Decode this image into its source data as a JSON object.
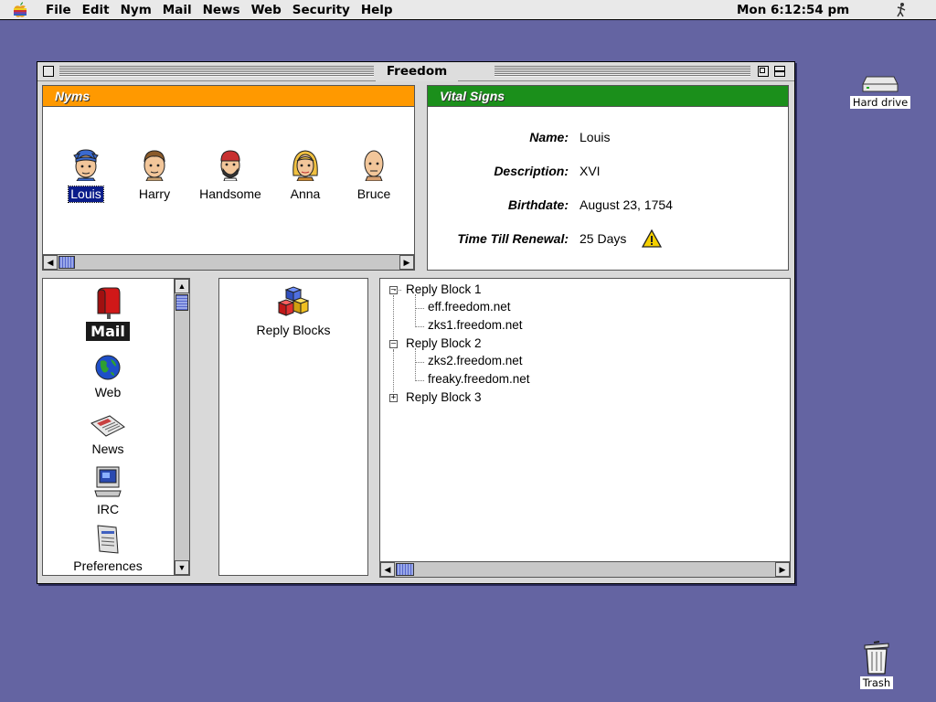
{
  "menubar": {
    "apple_icon": "apple-icon",
    "items": [
      "File",
      "Edit",
      "Nym",
      "Mail",
      "News",
      "Web",
      "Security",
      "Help"
    ],
    "clock": "Mon 6:12:54 pm",
    "app_icon": "running-figure-icon"
  },
  "desktop": {
    "hard_drive_label": "Hard drive",
    "trash_label": "Trash"
  },
  "window": {
    "title": "Freedom"
  },
  "nyms": {
    "header": "Nyms",
    "header_color": "#ff9900",
    "items": [
      {
        "label": "Louis",
        "selected": true
      },
      {
        "label": "Harry"
      },
      {
        "label": "Handsome"
      },
      {
        "label": "Anna"
      },
      {
        "label": "Bruce"
      }
    ]
  },
  "vital_signs": {
    "header": "Vital Signs",
    "header_color": "#1b8f1b",
    "rows": [
      {
        "label": "Name:",
        "value": "Louis"
      },
      {
        "label": "Description:",
        "value": "XVI"
      },
      {
        "label": "Birthdate:",
        "value": "August 23, 1754"
      },
      {
        "label": "Time Till Renewal:",
        "value": "25 Days",
        "icon": "warning-icon"
      }
    ]
  },
  "sidebar": {
    "items": [
      {
        "label": "Mail",
        "icon": "mailbox-icon",
        "selected": true
      },
      {
        "label": "Web",
        "icon": "globe-icon"
      },
      {
        "label": "News",
        "icon": "newspaper-icon"
      },
      {
        "label": "IRC",
        "icon": "computer-icon"
      },
      {
        "label": "Preferences",
        "icon": "preferences-icon"
      }
    ]
  },
  "middle": {
    "item_label": "Reply Blocks",
    "item_icon": "blocks-icon"
  },
  "tree": {
    "nodes": [
      {
        "label": "Reply Block 1",
        "expanded": true,
        "children": [
          "eff.freedom.net",
          "zks1.freedom.net"
        ]
      },
      {
        "label": "Reply Block 2",
        "expanded": true,
        "children": [
          "zks2.freedom.net",
          "freaky.freedom.net"
        ]
      },
      {
        "label": "Reply Block 3",
        "expanded": false,
        "children": []
      }
    ]
  },
  "colors": {
    "desktop": "#6464a2",
    "selection": "#0a1c8a"
  }
}
